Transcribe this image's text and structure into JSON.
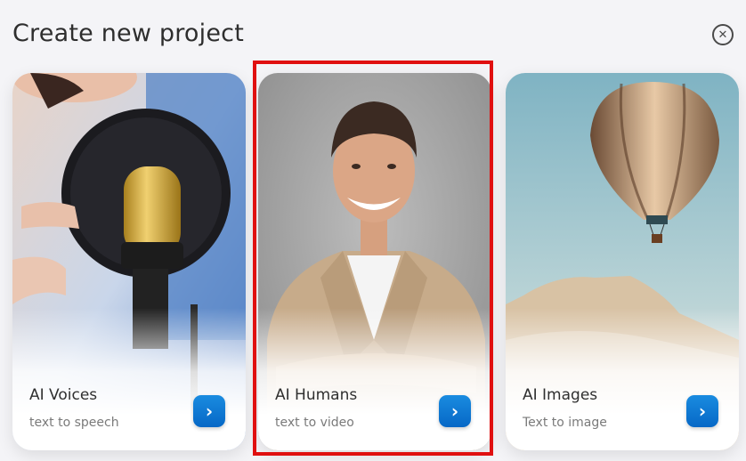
{
  "header": {
    "title": "Create new project",
    "close_glyph": "✕"
  },
  "cards": [
    {
      "label": "AI Voices",
      "subtitle": "text to speech",
      "button_glyph": "›",
      "icon": "chevron-right-icon"
    },
    {
      "label": "AI Humans",
      "subtitle": "text to video",
      "button_glyph": "›",
      "icon": "chevron-right-icon"
    },
    {
      "label": "AI Images",
      "subtitle": "Text to image",
      "button_glyph": "›",
      "icon": "chevron-right-icon"
    }
  ],
  "colors": {
    "accent_button": "#0a78d6",
    "highlight_border": "#e01010",
    "background": "#f4f4f7"
  }
}
